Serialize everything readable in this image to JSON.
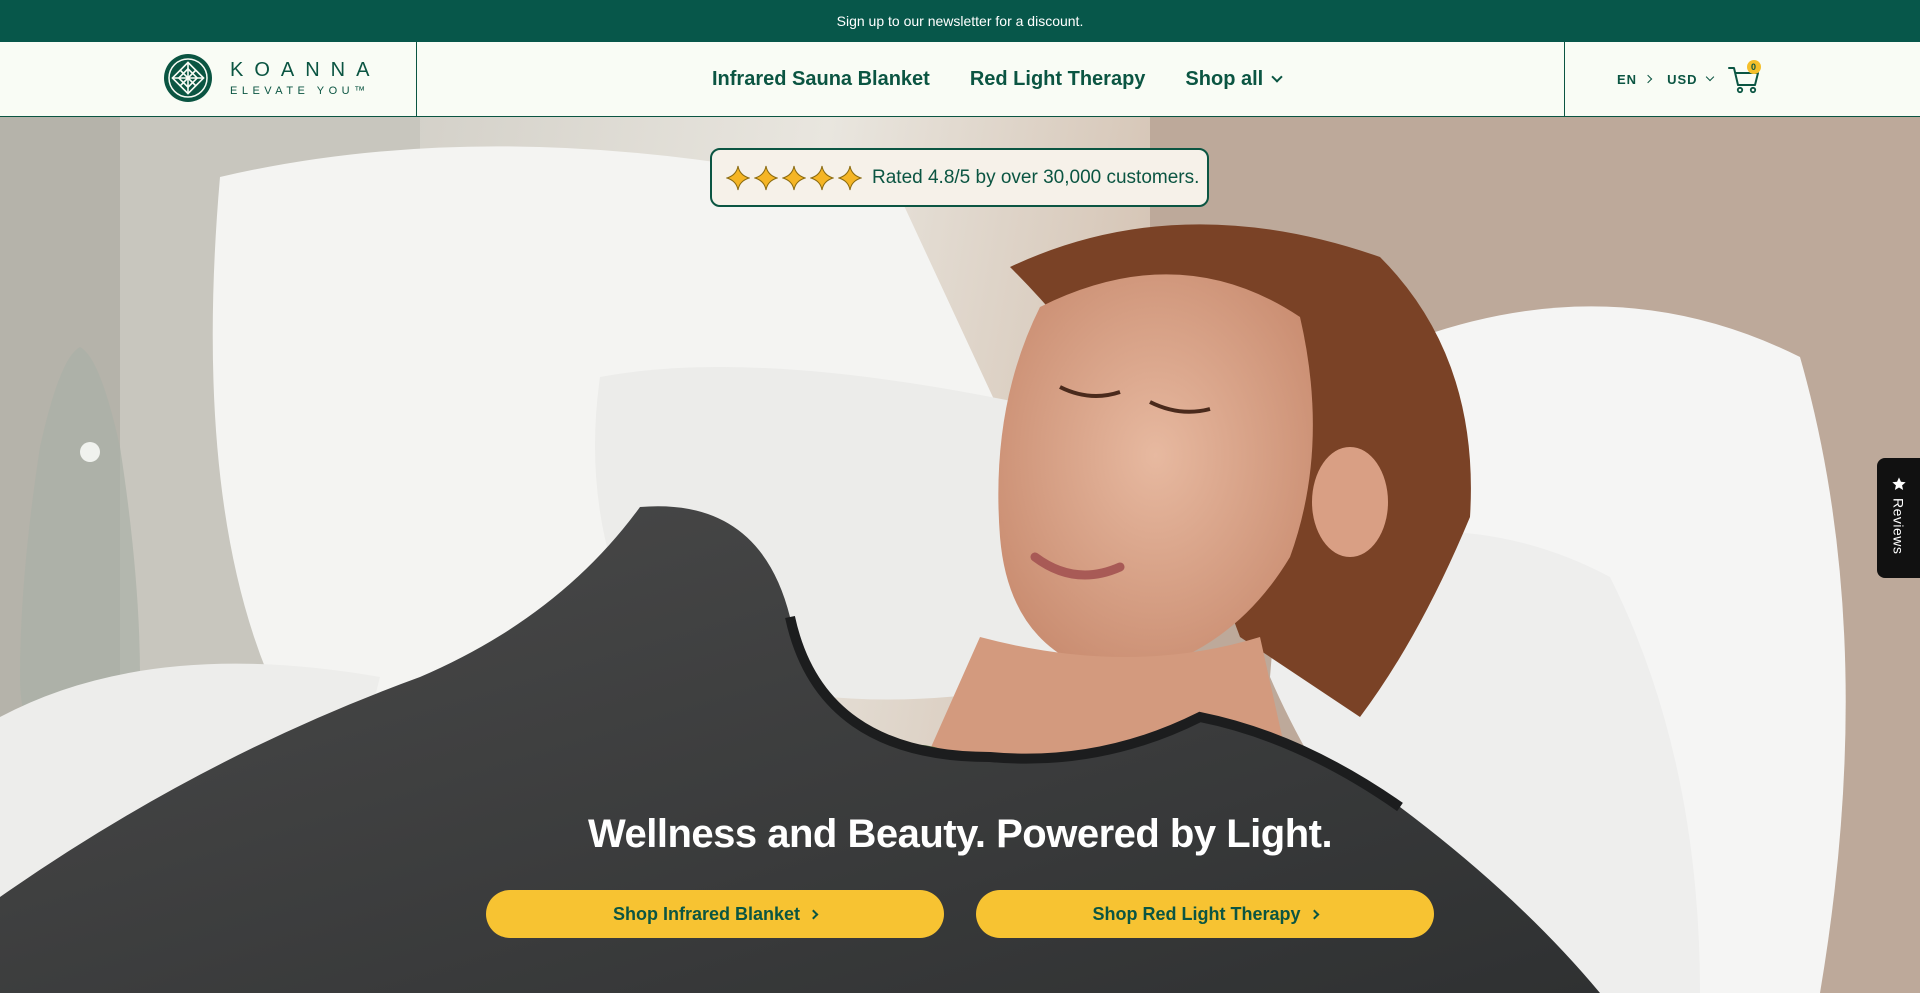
{
  "announcement": {
    "text": "Sign up to our newsletter for a discount."
  },
  "logo": {
    "name": "KOANNA",
    "tagline": "ELEVATE YOU™",
    "icon": "koanna-logo-icon"
  },
  "nav": {
    "items": [
      {
        "label": "Infrared Sauna Blanket"
      },
      {
        "label": "Red Light Therapy"
      },
      {
        "label": "Shop all",
        "has_dropdown": true
      }
    ]
  },
  "utilities": {
    "language": "EN",
    "currency": "USD",
    "cart_count": "0",
    "cart_icon": "cart-icon"
  },
  "rating": {
    "stars": 5,
    "text": "Rated 4.8/5 by over 30,000 customers.",
    "star_color": "#f5b525"
  },
  "hero": {
    "headline": "Wellness and Beauty. Powered by Light.",
    "buttons": [
      {
        "label": "Shop Infrared Blanket"
      },
      {
        "label": "Shop Red Light Therapy"
      }
    ]
  },
  "reviews_tab": {
    "label": "Reviews",
    "icon": "star-icon"
  },
  "colors": {
    "brand_green": "#07574a",
    "text_green": "#0b5542",
    "accent_yellow": "#f7c332",
    "header_bg": "#f9fcf5"
  }
}
